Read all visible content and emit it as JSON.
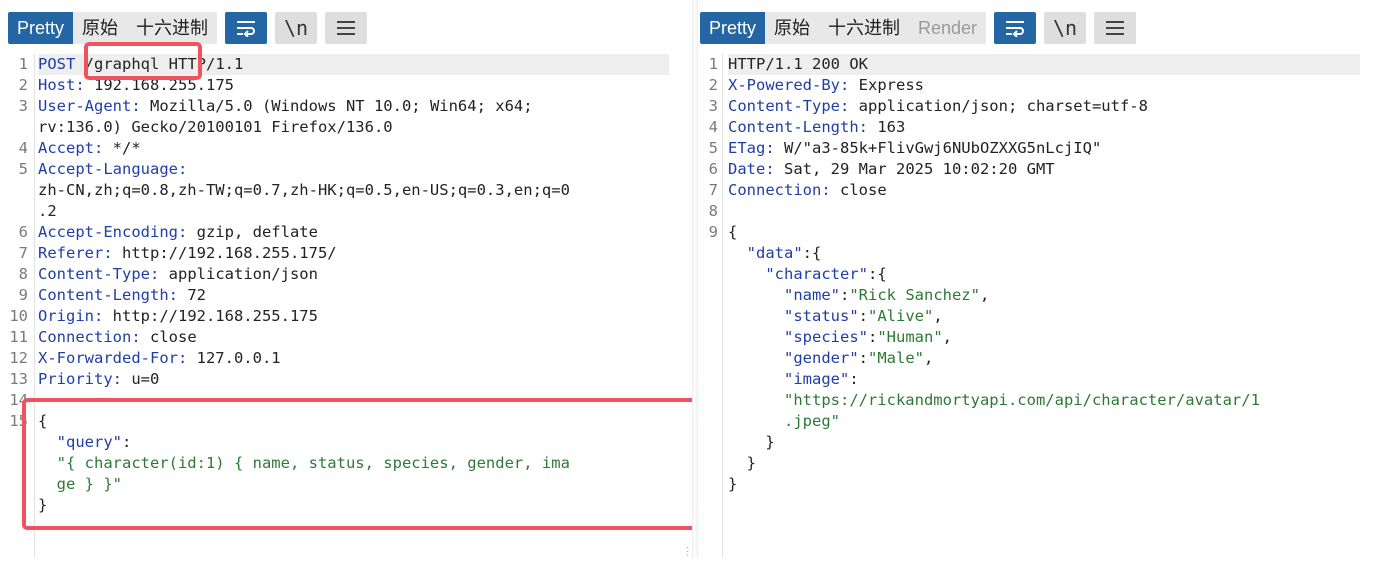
{
  "left": {
    "tabs": [
      "Pretty",
      "原始",
      "十六进制"
    ],
    "active_tab": "Pretty",
    "buttons": {
      "wrap": "wrap",
      "newline": "\\n",
      "menu": "menu"
    },
    "lines": [
      {
        "n": "1",
        "k": "POST ",
        "v": "/graphql HTTP/1.1"
      },
      {
        "n": "2",
        "k": "Host:",
        "v": " 192.168.255.175"
      },
      {
        "n": "3",
        "k": "User-Agent:",
        "v": " Mozilla/5.0 (Windows NT 10.0; Win64; x64;"
      },
      {
        "n": "",
        "k": "",
        "v": "rv:136.0) Gecko/20100101 Firefox/136.0"
      },
      {
        "n": "4",
        "k": "Accept:",
        "v": " */*"
      },
      {
        "n": "5",
        "k": "Accept-Language:",
        "v": ""
      },
      {
        "n": "",
        "k": "",
        "v": "zh-CN,zh;q=0.8,zh-TW;q=0.7,zh-HK;q=0.5,en-US;q=0.3,en;q=0"
      },
      {
        "n": "",
        "k": "",
        "v": ".2"
      },
      {
        "n": "6",
        "k": "Accept-Encoding:",
        "v": " gzip, deflate"
      },
      {
        "n": "7",
        "k": "Referer:",
        "v": " http://192.168.255.175/"
      },
      {
        "n": "8",
        "k": "Content-Type:",
        "v": " application/json"
      },
      {
        "n": "9",
        "k": "Content-Length:",
        "v": " 72"
      },
      {
        "n": "10",
        "k": "Origin:",
        "v": " http://192.168.255.175"
      },
      {
        "n": "11",
        "k": "Connection:",
        "v": " close"
      },
      {
        "n": "12",
        "k": "X-Forwarded-For:",
        "v": " 127.0.0.1"
      },
      {
        "n": "13",
        "k": "Priority:",
        "v": " u=0"
      },
      {
        "n": "14",
        "k": "",
        "v": ""
      },
      {
        "n": "15",
        "k": "",
        "v": "{"
      },
      {
        "n": "",
        "k": "  \"query\"",
        "v": ":"
      },
      {
        "n": "",
        "k": "",
        "v": "  \"{ character(id:1) { name, status, species, gender, ima",
        "s": true
      },
      {
        "n": "",
        "k": "",
        "v": "  ge } }\"",
        "s": true
      },
      {
        "n": "",
        "k": "",
        "v": "}"
      }
    ]
  },
  "right": {
    "tabs": [
      "Pretty",
      "原始",
      "十六进制",
      "Render"
    ],
    "active_tab": "Pretty",
    "buttons": {
      "wrap": "wrap",
      "newline": "\\n",
      "menu": "menu"
    },
    "lines": [
      {
        "n": "1",
        "k": "",
        "v": "HTTP/1.1 200 OK"
      },
      {
        "n": "2",
        "k": "X-Powered-By:",
        "v": " Express"
      },
      {
        "n": "3",
        "k": "Content-Type:",
        "v": " application/json; charset=utf-8"
      },
      {
        "n": "4",
        "k": "Content-Length:",
        "v": " 163"
      },
      {
        "n": "5",
        "k": "ETag:",
        "v": " W/\"a3-85k+FlivGwj6NUbOZXXG5nLcjIQ\""
      },
      {
        "n": "6",
        "k": "Date:",
        "v": " Sat, 29 Mar 2025 10:02:20 GMT"
      },
      {
        "n": "7",
        "k": "Connection:",
        "v": " close"
      },
      {
        "n": "8",
        "k": "",
        "v": ""
      },
      {
        "n": "9",
        "k": "",
        "v": "{"
      },
      {
        "n": "",
        "k": "  \"data\"",
        "v": ":{"
      },
      {
        "n": "",
        "k": "    \"character\"",
        "v": ":{"
      },
      {
        "n": "",
        "k": "      \"name\"",
        "v": ":",
        "s2": "\"Rick Sanchez\"",
        "t": ","
      },
      {
        "n": "",
        "k": "      \"status\"",
        "v": ":",
        "s2": "\"Alive\"",
        "t": ","
      },
      {
        "n": "",
        "k": "      \"species\"",
        "v": ":",
        "s2": "\"Human\"",
        "t": ","
      },
      {
        "n": "",
        "k": "      \"gender\"",
        "v": ":",
        "s2": "\"Male\"",
        "t": ","
      },
      {
        "n": "",
        "k": "      \"image\"",
        "v": ":"
      },
      {
        "n": "",
        "k": "",
        "v": "      \"https://rickandmortyapi.com/api/character/avatar/1",
        "s": true
      },
      {
        "n": "",
        "k": "",
        "v": "      .jpeg\"",
        "s": true
      },
      {
        "n": "",
        "k": "",
        "v": "    }"
      },
      {
        "n": "",
        "k": "",
        "v": "  }"
      },
      {
        "n": "",
        "k": "",
        "v": "}"
      }
    ]
  }
}
